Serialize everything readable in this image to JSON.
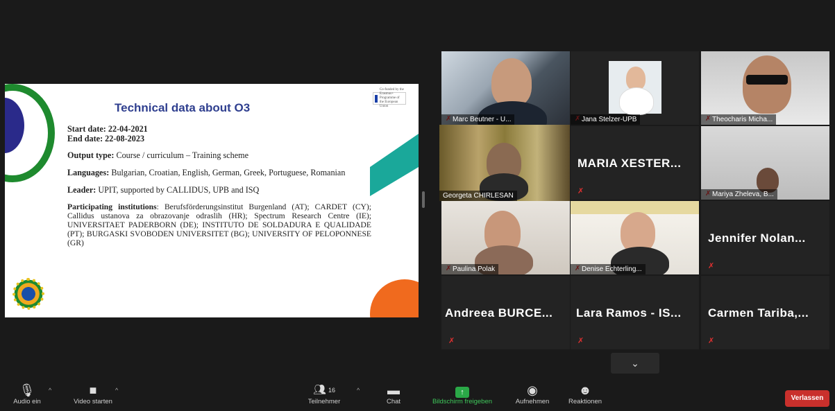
{
  "slide": {
    "title": "Technical data about O3",
    "eu_logo_text": "Co-funded by the Erasmus+ Programme of the European Union",
    "start_date": "Start date: 22-04-2021",
    "end_date": "End date:  22-08-2023",
    "output_label": "Output type:",
    "output_value": " Course / curriculum – Training scheme",
    "languages_label": "Languages:",
    "languages_value": " Bulgarian, Croatian, English, German, Greek, Portuguese, Romanian",
    "leader_label": "Leader:",
    "leader_value": " UPIT, supported by CALLIDUS, UPB and ISQ",
    "participating_label": "Participating institutions",
    "participating_value": ":  Berufsförderungsinstitut Burgenland (AT); CARDET (CY); Callidus ustanova za obrazovanje odraslih (HR); Spectrum Research Centre (IE); UNIVERSITAET PADERBORN (DE); INSTITUTO DE SOLDADURA E QUALIDADE (PT); BURGASKI SVOBODEN UNIVERSITET (BG); UNIVERSITY OF PELOPONNESE (GR)"
  },
  "participants": [
    {
      "name": "Marc Beutner - U...",
      "mic": "muted"
    },
    {
      "name": "Jana Stelzer-UPB",
      "mic": "muted"
    },
    {
      "name": "Theocharis Micha...",
      "mic": "muted"
    },
    {
      "name": "Georgeta CHIRLESAN",
      "mic": "none"
    },
    {
      "name": "MARIA XESTER...",
      "mic": "muted"
    },
    {
      "name": "Mariya Zheleva, B...",
      "mic": "muted"
    },
    {
      "name": "Paulina Polak",
      "mic": "muted"
    },
    {
      "name": "Denise Echterling...",
      "mic": "muted"
    },
    {
      "name": "Jennifer Nolan...",
      "mic": "muted"
    },
    {
      "name": "Andreea BURCE...",
      "mic": "muted"
    },
    {
      "name": "Lara Ramos - IS...",
      "mic": "muted"
    },
    {
      "name": "Carmen Tariba,...",
      "mic": "muted"
    }
  ],
  "toolbar": {
    "audio": "Audio ein",
    "video": "Video starten",
    "participants": "Teilnehmer",
    "participant_count": "16",
    "chat": "Chat",
    "share": "Bildschirm freigeben",
    "record": "Aufnehmen",
    "reactions": "Reaktionen",
    "leave": "Verlassen"
  },
  "icons": [
    "mic-muted-icon",
    "video-off-icon",
    "participants-icon",
    "chat-icon",
    "share-screen-icon",
    "record-icon",
    "reactions-icon",
    "chevron-down-icon"
  ],
  "colors": {
    "leave": "#c9302c",
    "share": "#2aa847",
    "active_speaker": "#e7d46a",
    "muted": "#e03030"
  }
}
